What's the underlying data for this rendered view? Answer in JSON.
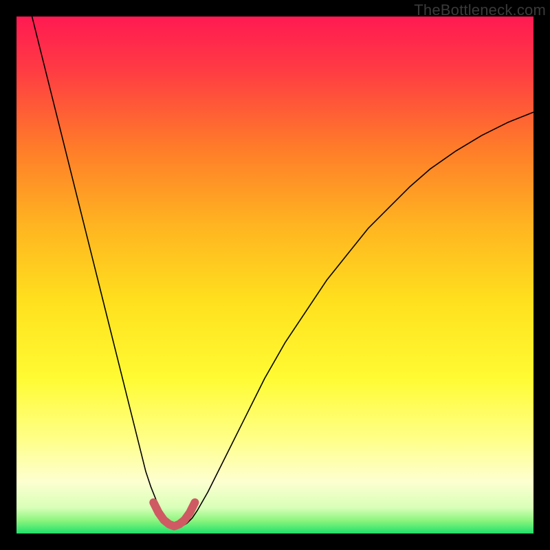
{
  "watermark": "TheBottleneck.com",
  "chart_data": {
    "type": "line",
    "title": "",
    "xlabel": "",
    "ylabel": "",
    "xlim": [
      0,
      100
    ],
    "ylim": [
      0,
      100
    ],
    "background_gradient": {
      "stops": [
        {
          "offset": 0.0,
          "color": "#ff1a52"
        },
        {
          "offset": 0.1,
          "color": "#ff3a44"
        },
        {
          "offset": 0.25,
          "color": "#ff7a2a"
        },
        {
          "offset": 0.4,
          "color": "#ffb321"
        },
        {
          "offset": 0.55,
          "color": "#ffe01e"
        },
        {
          "offset": 0.7,
          "color": "#fffb33"
        },
        {
          "offset": 0.82,
          "color": "#ffff8a"
        },
        {
          "offset": 0.9,
          "color": "#fdffd0"
        },
        {
          "offset": 0.95,
          "color": "#d8ffb8"
        },
        {
          "offset": 0.975,
          "color": "#8cf57e"
        },
        {
          "offset": 1.0,
          "color": "#1ee06a"
        }
      ]
    },
    "series": [
      {
        "name": "bottleneck-curve",
        "stroke": "#000000",
        "stroke_width": 1.6,
        "x": [
          3,
          5,
          7,
          9,
          11,
          13,
          15,
          17,
          19,
          21,
          22,
          23,
          24,
          25,
          26,
          27,
          28,
          29,
          30,
          31,
          32,
          33,
          34,
          35,
          37,
          40,
          44,
          48,
          52,
          56,
          60,
          64,
          68,
          72,
          76,
          80,
          85,
          90,
          95,
          100
        ],
        "y": [
          100,
          92,
          84,
          76,
          68,
          60,
          52,
          44,
          36,
          28,
          24,
          20,
          16,
          12,
          9,
          6.5,
          4.5,
          3,
          2,
          1.4,
          1.4,
          2,
          3,
          4.5,
          8,
          14,
          22,
          30,
          37,
          43,
          49,
          54,
          59,
          63,
          67,
          70.5,
          74,
          77,
          79.5,
          81.5
        ]
      },
      {
        "name": "optimal-band",
        "stroke": "#cf5a63",
        "stroke_width": 12,
        "linecap": "round",
        "x": [
          26.5,
          27.5,
          28.5,
          29.5,
          30.5,
          31.5,
          32.5,
          33.5,
          34.5
        ],
        "y": [
          6.0,
          4.0,
          2.6,
          1.8,
          1.4,
          1.8,
          2.6,
          4.0,
          6.0
        ]
      }
    ]
  }
}
